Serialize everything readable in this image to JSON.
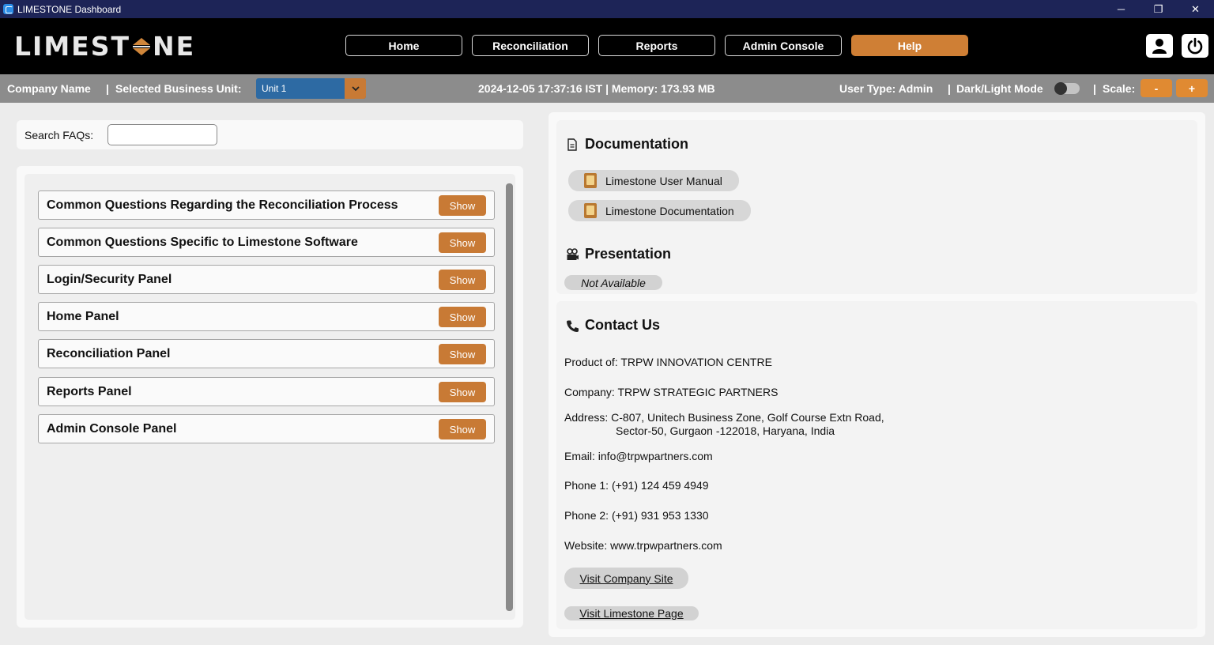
{
  "window": {
    "title": "LIMESTONE Dashboard",
    "minimize": "─",
    "restore": "❐",
    "close": "✕"
  },
  "logo": {
    "left_text": "LIM",
    "right_text": "ESTNE",
    "full": "LIMESTONE"
  },
  "nav": {
    "items": [
      {
        "label": "Home",
        "active": false
      },
      {
        "label": "Reconciliation",
        "active": false
      },
      {
        "label": "Reports",
        "active": false
      },
      {
        "label": "Admin Console",
        "active": false
      },
      {
        "label": "Help",
        "active": true
      }
    ]
  },
  "status": {
    "company_name": "Company Name",
    "sep1": "|",
    "business_unit_label": "Selected Business Unit:",
    "business_unit_value": "Unit 1",
    "datetime_memory": "2024-12-05 17:37:16 IST | Memory: 173.93 MB",
    "user_type": "User Type: Admin",
    "sep2": "|",
    "mode_label": "Dark/Light Mode",
    "sep3": "|",
    "scale_label": "Scale:",
    "scale_minus": "-",
    "scale_plus": "+"
  },
  "faq": {
    "search_label": "Search FAQs:",
    "search_value": "",
    "show_label": "Show",
    "items": [
      "Common Questions Regarding the Reconciliation Process",
      "Common Questions Specific to Limestone Software",
      "Login/Security Panel",
      "Home Panel",
      "Reconciliation Panel",
      "Reports Panel",
      "Admin Console Panel"
    ]
  },
  "documentation": {
    "title": "Documentation",
    "links": [
      "Limestone User Manual",
      "Limestone Documentation"
    ]
  },
  "presentation": {
    "title": "Presentation",
    "status": "Not Available"
  },
  "contact": {
    "title": "Contact Us",
    "product": "Product of: TRPW INNOVATION CENTRE",
    "company": "Company: TRPW STRATEGIC PARTNERS",
    "address_line1": "Address: C-807, Unitech Business Zone, Golf Course Extn Road,",
    "address_line2": "Sector-50, Gurgaon -122018, Haryana, India",
    "email": "Email: info@trpwpartners.com",
    "phone1": "Phone 1: (+91) 124 459 4949",
    "phone2": "Phone 2: (+91) 931 953 1330",
    "website": "Website: www.trpwpartners.com",
    "visit_company": "Visit Company Site",
    "visit_limestone": "Visit Limestone Page"
  },
  "colors": {
    "accent": "#cf7f35",
    "titlebar": "#1d2457",
    "statusbar": "#8c8c8c",
    "unit_select": "#2d6aa3"
  }
}
